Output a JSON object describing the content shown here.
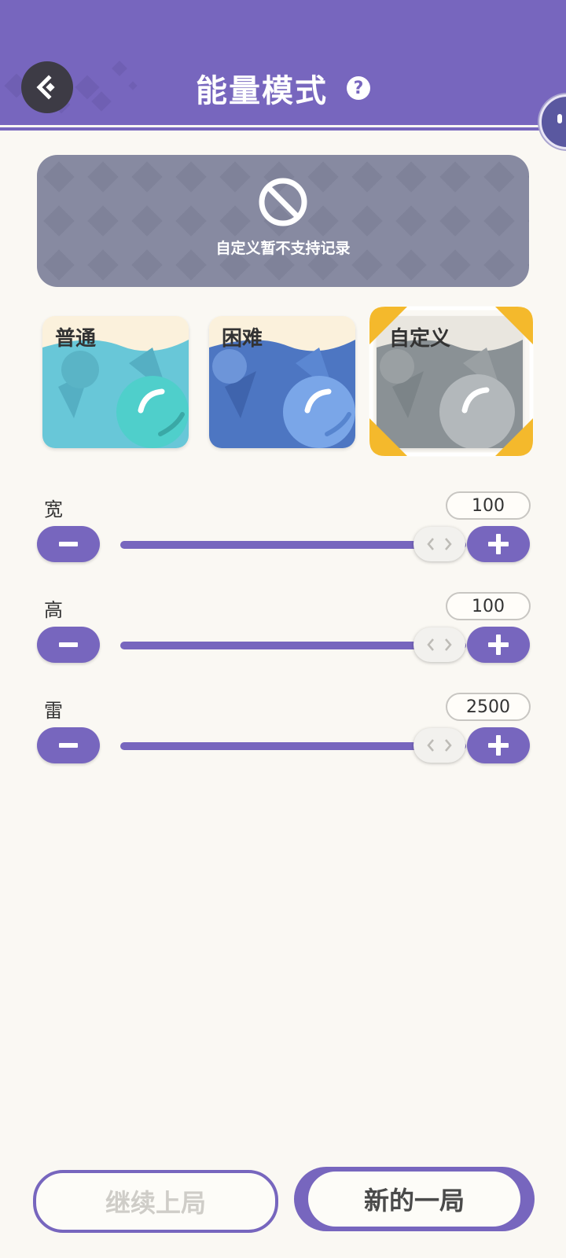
{
  "header": {
    "title": "能量模式",
    "help_glyph": "?",
    "back_icon": "back-diamond-arrow-icon",
    "background_color": "#7766be"
  },
  "banner": {
    "icon": "prohibited-icon",
    "text": "自定义暂不支持记录"
  },
  "modes": [
    {
      "label": "普通",
      "selected": false,
      "color": "#68c7d8"
    },
    {
      "label": "困难",
      "selected": false,
      "color": "#4d76c2"
    },
    {
      "label": "自定义",
      "selected": true,
      "color": "#8a9195"
    }
  ],
  "settings": [
    {
      "label": "宽",
      "value": "100"
    },
    {
      "label": "高",
      "value": "100"
    },
    {
      "label": "雷",
      "value": "2500"
    }
  ],
  "buttons": {
    "continue": "继续上局",
    "new_game": "新的一局"
  },
  "accent_color": "#7766be",
  "selected_corner_color": "#f4b92c"
}
